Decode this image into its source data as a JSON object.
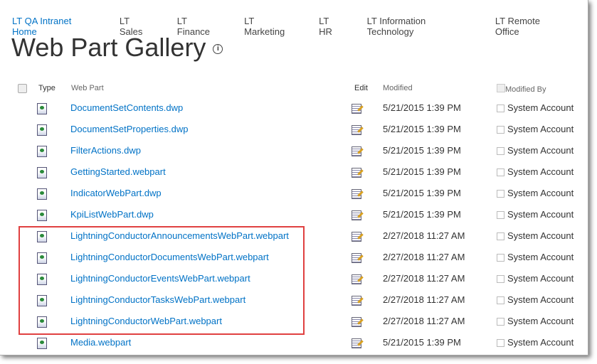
{
  "nav": [
    "LT QA Intranet Home",
    "LT Sales",
    "LT Finance",
    "LT Marketing",
    "LT HR",
    "LT Information Technology",
    "LT Remote Office"
  ],
  "title": "Web Part Gallery",
  "columns": {
    "type": "Type",
    "web_part": "Web Part",
    "edit": "Edit",
    "modified": "Modified",
    "modified_by": "Modified By"
  },
  "rows": [
    {
      "name": "DocumentSetContents.dwp",
      "modified": "5/21/2015 1:39 PM",
      "by": "System Account"
    },
    {
      "name": "DocumentSetProperties.dwp",
      "modified": "5/21/2015 1:39 PM",
      "by": "System Account"
    },
    {
      "name": "FilterActions.dwp",
      "modified": "5/21/2015 1:39 PM",
      "by": "System Account"
    },
    {
      "name": "GettingStarted.webpart",
      "modified": "5/21/2015 1:39 PM",
      "by": "System Account"
    },
    {
      "name": "IndicatorWebPart.dwp",
      "modified": "5/21/2015 1:39 PM",
      "by": "System Account"
    },
    {
      "name": "KpiListWebPart.dwp",
      "modified": "5/21/2015 1:39 PM",
      "by": "System Account"
    },
    {
      "name": "LightningConductorAnnouncementsWebPart.webpart",
      "modified": "2/27/2018 11:27 AM",
      "by": "System Account"
    },
    {
      "name": "LightningConductorDocumentsWebPart.webpart",
      "modified": "2/27/2018 11:27 AM",
      "by": "System Account"
    },
    {
      "name": "LightningConductorEventsWebPart.webpart",
      "modified": "2/27/2018 11:27 AM",
      "by": "System Account"
    },
    {
      "name": "LightningConductorTasksWebPart.webpart",
      "modified": "2/27/2018 11:27 AM",
      "by": "System Account"
    },
    {
      "name": "LightningConductorWebPart.webpart",
      "modified": "2/27/2018 11:27 AM",
      "by": "System Account"
    },
    {
      "name": "Media.webpart",
      "modified": "5/21/2015 1:39 PM",
      "by": "System Account"
    }
  ]
}
